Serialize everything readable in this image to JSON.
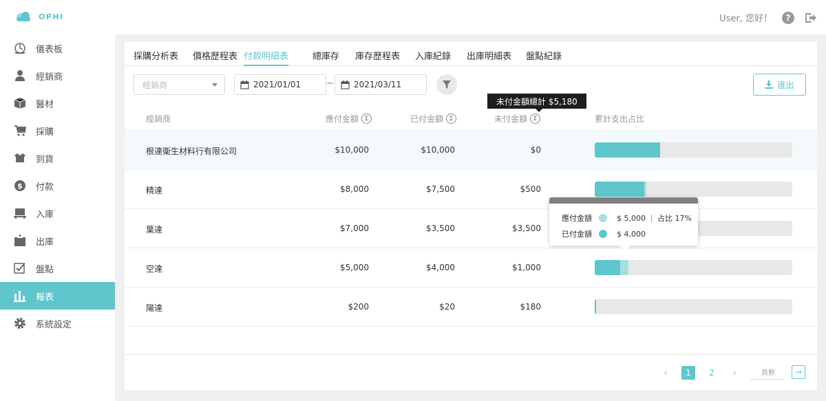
{
  "brand": {
    "name": "OPHI",
    "accent": "#5ec6cc"
  },
  "header": {
    "greeting": "User, 您好！",
    "help_icon": "question-circle-icon",
    "logout_icon": "logout-icon"
  },
  "sidebar": {
    "items": [
      {
        "label": "儀表板",
        "icon": "dashboard-icon"
      },
      {
        "label": "經銷商",
        "icon": "person-icon"
      },
      {
        "label": "醫材",
        "icon": "box-icon"
      },
      {
        "label": "採購",
        "icon": "cart-icon"
      },
      {
        "label": "到貨",
        "icon": "open-box-icon"
      },
      {
        "label": "付款",
        "icon": "dollar-icon"
      },
      {
        "label": "入庫",
        "icon": "warehouse-in-icon"
      },
      {
        "label": "出庫",
        "icon": "warehouse-out-icon"
      },
      {
        "label": "盤點",
        "icon": "checklist-icon"
      },
      {
        "label": "報表",
        "icon": "bar-chart-icon",
        "active": true
      },
      {
        "label": "系統設定",
        "icon": "gear-icon"
      }
    ]
  },
  "tabs": [
    {
      "label": "採購分析表"
    },
    {
      "label": "價格歷程表"
    },
    {
      "label": "付款明細表",
      "active": true
    },
    {
      "label": "總庫存"
    },
    {
      "label": "庫存歷程表"
    },
    {
      "label": "入庫紀錄"
    },
    {
      "label": "出庫明細表"
    },
    {
      "label": "盤點紀錄"
    }
  ],
  "filters": {
    "dealer_placeholder": "經銷商",
    "date_from": "2021/01/01",
    "date_separator": "~",
    "date_to": "2021/03/11",
    "export_label": "匯出"
  },
  "total_tooltip": "未付金額總計 $5,180",
  "table": {
    "headers": {
      "dealer": "經銷商",
      "payable": "應付金額",
      "paid": "已付金額",
      "unpaid": "未付金額",
      "ratio": "累計支出占比",
      "sum_symbol": "Σ"
    },
    "rows": [
      {
        "dealer": "根達衛生材料行有限公司",
        "payable": "$10,000",
        "paid": "$10,000",
        "unpaid": "$0",
        "payable_share": 0.33,
        "paid_share": 0.33
      },
      {
        "dealer": "精達",
        "payable": "$8,000",
        "paid": "$7,500",
        "unpaid": "$500",
        "payable_share": 0.26,
        "paid_share": 0.25
      },
      {
        "dealer": "葉達",
        "payable": "$7,000",
        "paid": "$3,500",
        "unpaid": "$3,500",
        "payable_share": 0.23,
        "paid_share": 0.12
      },
      {
        "dealer": "空達",
        "payable": "$5,000",
        "paid": "$4,000",
        "unpaid": "$1,000",
        "payable_share": 0.17,
        "paid_share": 0.13
      },
      {
        "dealer": "陽達",
        "payable": "$200",
        "paid": "$20",
        "unpaid": "$180",
        "payable_share": 0.0066,
        "paid_share": 0.0007
      }
    ]
  },
  "popover": {
    "payable_label": "應付金額",
    "payable_value": "$ 5,000",
    "share_label": "占比 17%",
    "paid_label": "已付金額",
    "paid_value": "$ 4,000",
    "payable_color": "#a8dfe3",
    "paid_color": "#5ec6cc"
  },
  "pagination": {
    "prev": "‹",
    "pages": [
      "1",
      "2"
    ],
    "current": "1",
    "next": "›",
    "page_input_placeholder": "頁數",
    "go": "→"
  }
}
